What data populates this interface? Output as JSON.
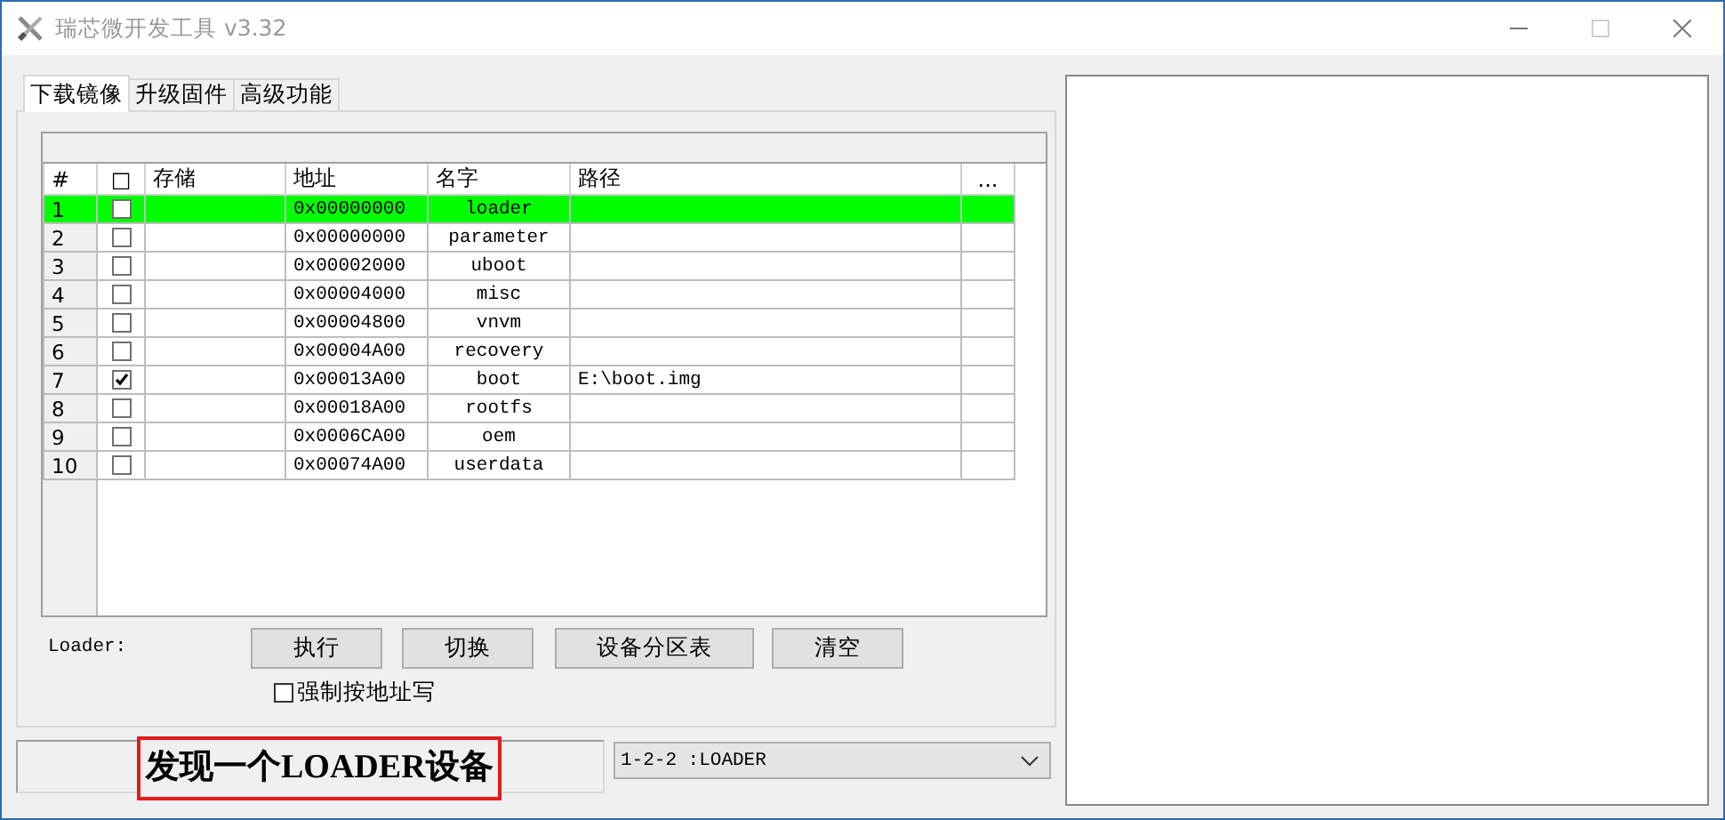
{
  "window": {
    "title": "瑞芯微开发工具 v3.32",
    "maximize_disabled": true
  },
  "tabs": [
    {
      "label": "下载镜像",
      "selected": true
    },
    {
      "label": "升级固件",
      "selected": false
    },
    {
      "label": "高级功能",
      "selected": false
    }
  ],
  "table": {
    "columns": [
      "#",
      "□",
      "存储",
      "地址",
      "名字",
      "路径",
      "..."
    ],
    "rows": [
      {
        "index": "1",
        "checked": false,
        "selected": true,
        "address": "0x00000000",
        "name": "loader",
        "path": ""
      },
      {
        "index": "2",
        "checked": false,
        "selected": false,
        "address": "0x00000000",
        "name": "parameter",
        "path": ""
      },
      {
        "index": "3",
        "checked": false,
        "selected": false,
        "address": "0x00002000",
        "name": "uboot",
        "path": ""
      },
      {
        "index": "4",
        "checked": false,
        "selected": false,
        "address": "0x00004000",
        "name": "misc",
        "path": ""
      },
      {
        "index": "5",
        "checked": false,
        "selected": false,
        "address": "0x00004800",
        "name": "vnvm",
        "path": ""
      },
      {
        "index": "6",
        "checked": false,
        "selected": false,
        "address": "0x00004A00",
        "name": "recovery",
        "path": ""
      },
      {
        "index": "7",
        "checked": true,
        "selected": false,
        "address": "0x00013A00",
        "name": "boot",
        "path": "E:\\boot.img"
      },
      {
        "index": "8",
        "checked": false,
        "selected": false,
        "address": "0x00018A00",
        "name": "rootfs",
        "path": ""
      },
      {
        "index": "9",
        "checked": false,
        "selected": false,
        "address": "0x0006CA00",
        "name": "oem",
        "path": ""
      },
      {
        "index": "10",
        "checked": false,
        "selected": false,
        "address": "0x00074A00",
        "name": "userdata",
        "path": ""
      }
    ]
  },
  "loader_label": "Loader:",
  "buttons": [
    "执行",
    "切换",
    "设备分区表",
    "清空"
  ],
  "force_address_write": {
    "label": "强制按地址写",
    "checked": false
  },
  "status": {
    "message": "发现一个LOADER设备",
    "device": "1-2-2 :LOADER"
  }
}
